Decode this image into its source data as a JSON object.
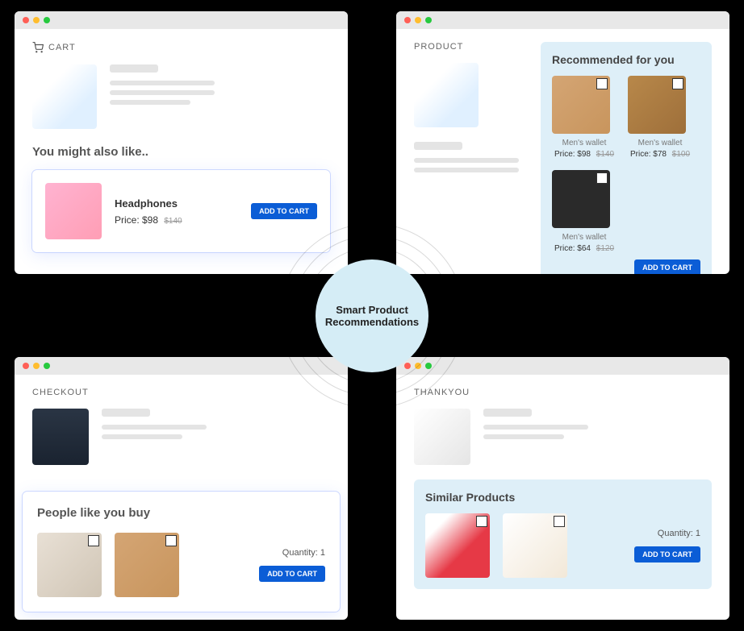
{
  "center_label": "Smart Product Recommendations",
  "cart": {
    "page_label": "CART",
    "section_title": "You might also like..",
    "product": {
      "name": "Headphones",
      "price_label": "Price: $98",
      "price_old": "$140",
      "add_label": "ADD TO CART"
    }
  },
  "product_page": {
    "page_label": "PRODUCT",
    "reco_title": "Recommended for you",
    "items": [
      {
        "name": "Men's wallet",
        "price_label": "Price: $98",
        "price_old": "$140"
      },
      {
        "name": "Men's wallet",
        "price_label": "Price: $78",
        "price_old": "$100"
      },
      {
        "name": "Men's wallet",
        "price_label": "Price: $64",
        "price_old": "$120"
      }
    ],
    "add_label": "ADD TO CART"
  },
  "checkout": {
    "page_label": "CHECKOUT",
    "section_title": "People like you buy",
    "qty_label": "Quantity: 1",
    "add_label": "ADD TO CART"
  },
  "thankyou": {
    "page_label": "THANKYOU",
    "section_title": "Similar Products",
    "qty_label": "Quantity: 1",
    "add_label": "ADD TO CART"
  }
}
